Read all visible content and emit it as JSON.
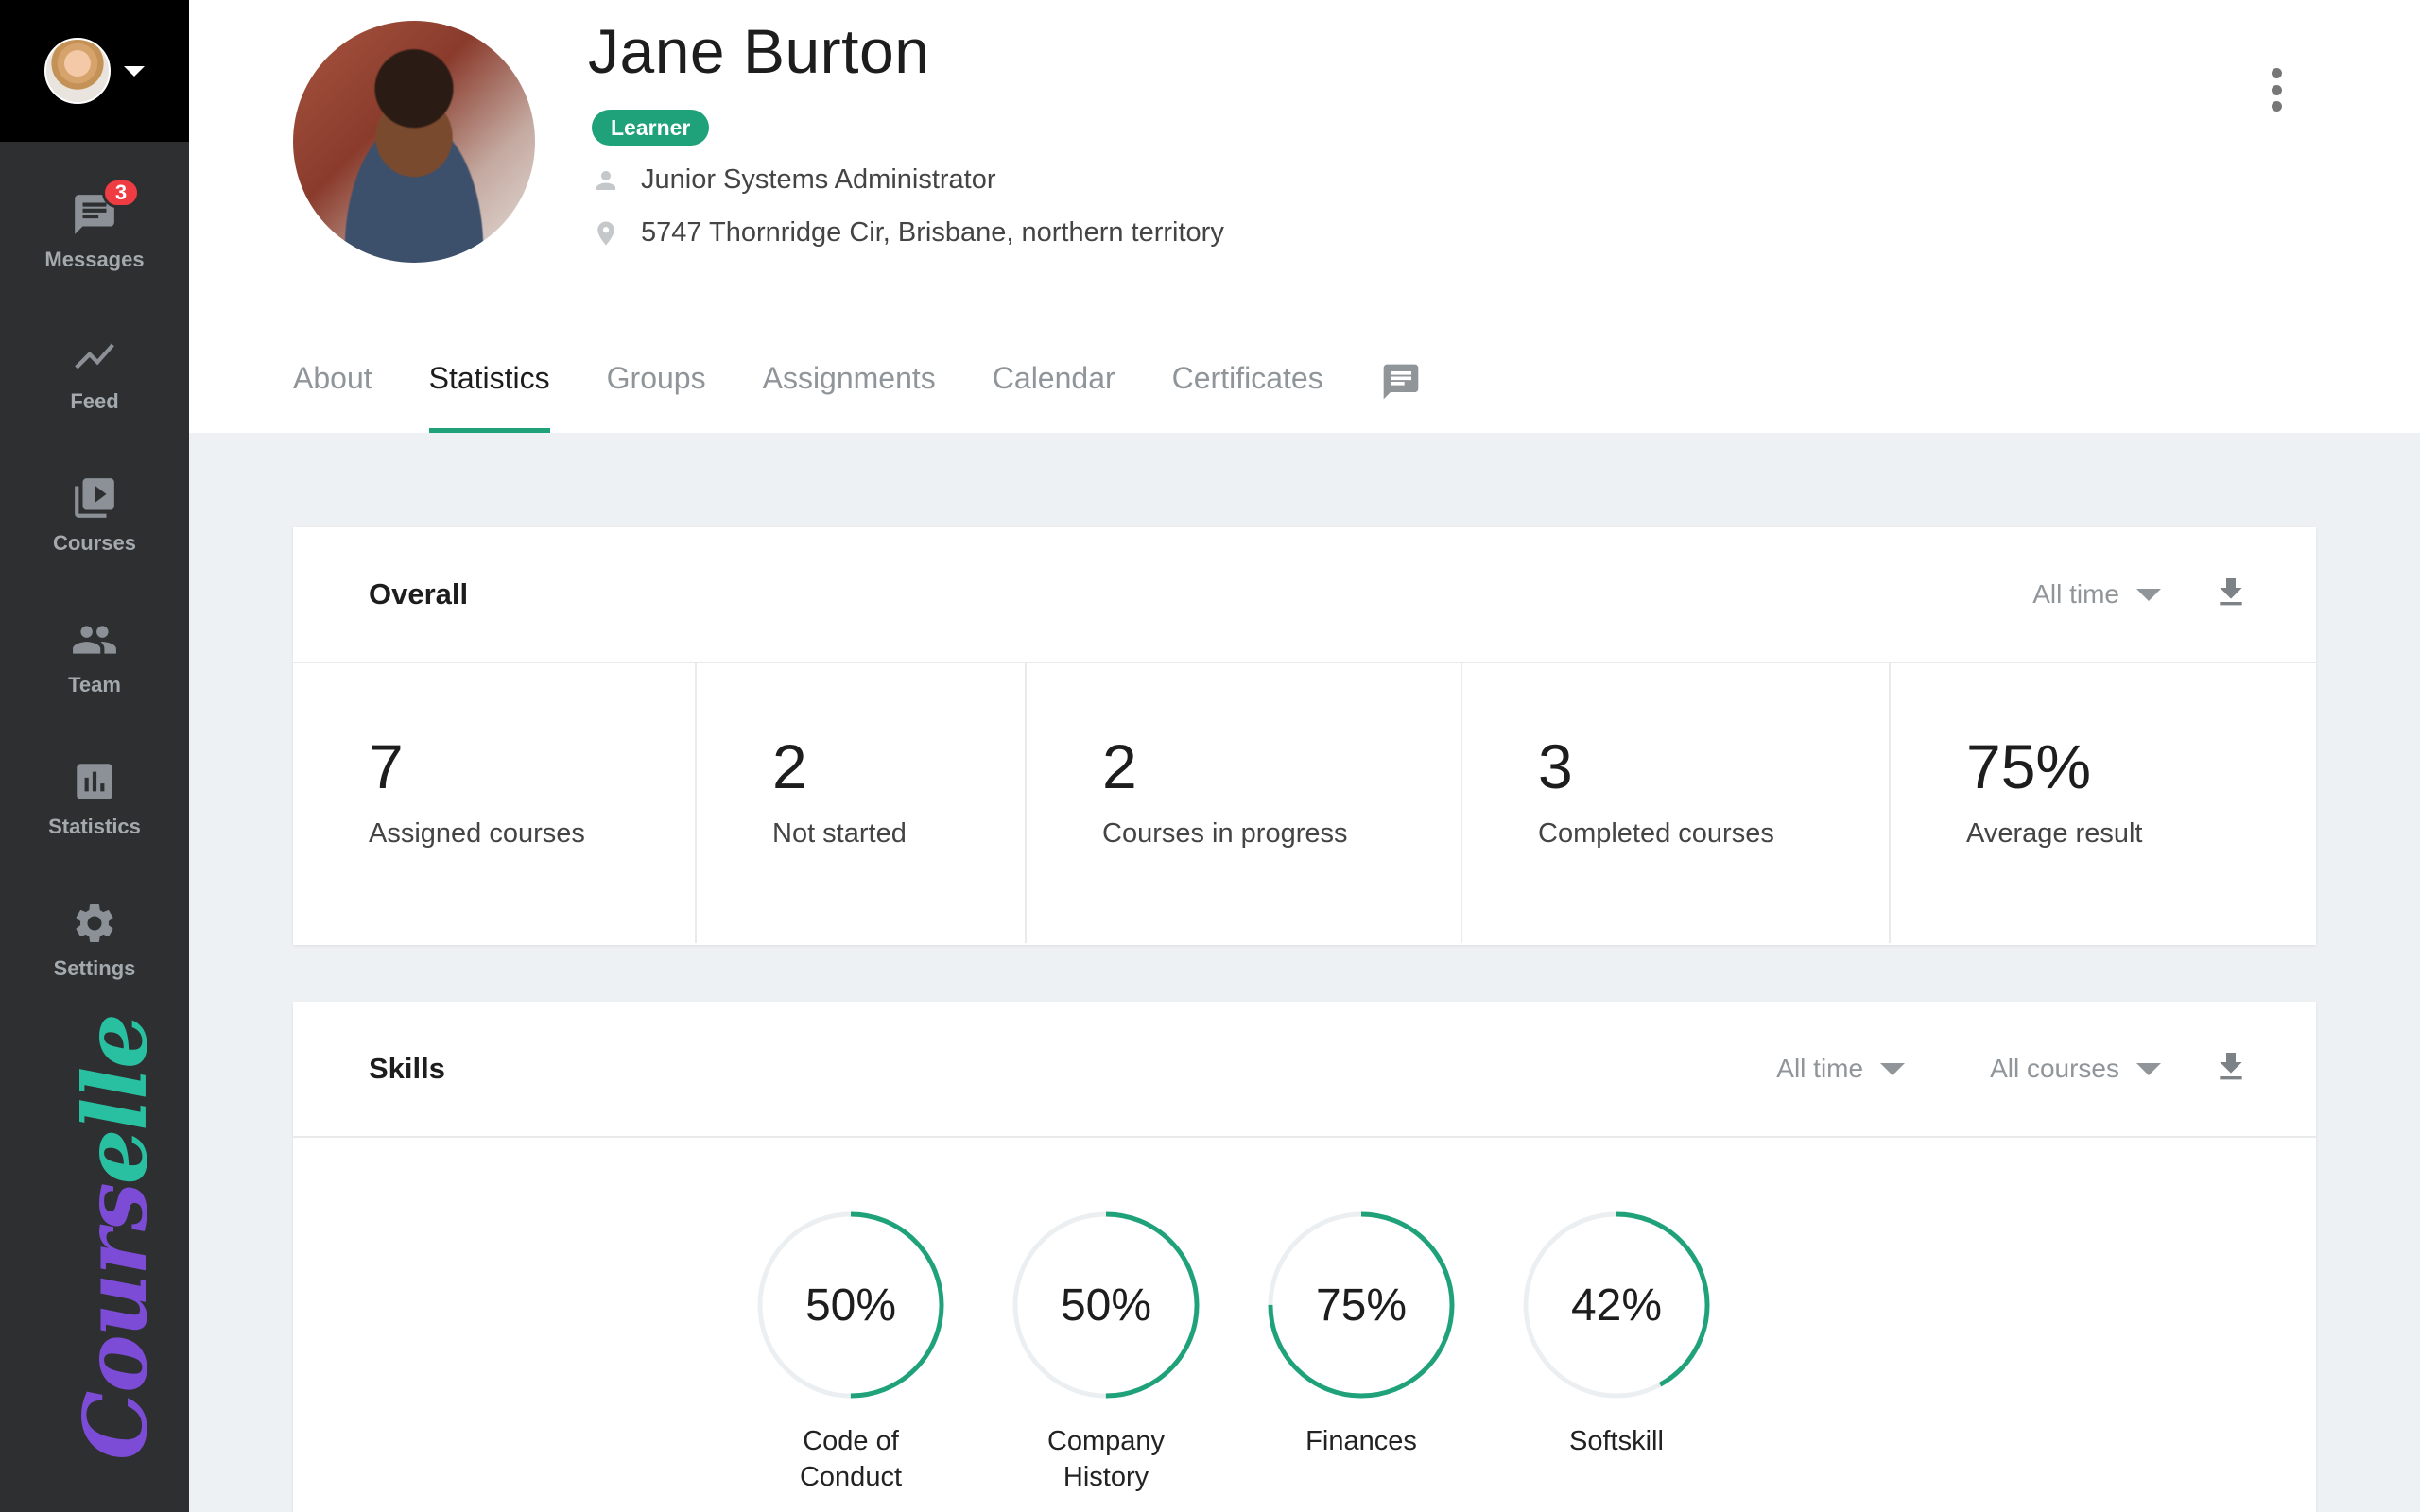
{
  "sidebar": {
    "items": [
      {
        "label": "Messages",
        "icon": "chat-icon",
        "badge": "3"
      },
      {
        "label": "Feed",
        "icon": "trend-icon"
      },
      {
        "label": "Courses",
        "icon": "video-library-icon"
      },
      {
        "label": "Team",
        "icon": "people-icon"
      },
      {
        "label": "Statistics",
        "icon": "bar-chart-icon"
      },
      {
        "label": "Settings",
        "icon": "gear-icon"
      }
    ],
    "logo_part1": "Cours",
    "logo_part2": "elle"
  },
  "profile": {
    "name": "Jane Burton",
    "role": "Learner",
    "job_title": "Junior Systems Administrator",
    "address": "5747 Thornridge Cir, Brisbane, northern territory"
  },
  "tabs": [
    {
      "label": "About",
      "active": false
    },
    {
      "label": "Statistics",
      "active": true
    },
    {
      "label": "Groups",
      "active": false
    },
    {
      "label": "Assignments",
      "active": false
    },
    {
      "label": "Calendar",
      "active": false
    },
    {
      "label": "Certificates",
      "active": false
    }
  ],
  "overall": {
    "title": "Overall",
    "filter": "All time",
    "stats": [
      {
        "value": "7",
        "label": "Assigned courses"
      },
      {
        "value": "2",
        "label": "Not started"
      },
      {
        "value": "2",
        "label": "Courses in progress"
      },
      {
        "value": "3",
        "label": "Completed courses"
      },
      {
        "value": "75%",
        "label": "Average result"
      }
    ]
  },
  "skills": {
    "title": "Skills",
    "time_filter": "All time",
    "course_filter": "All courses",
    "items": [
      {
        "pct": "50%",
        "value": 50,
        "label": "Code of Conduct"
      },
      {
        "pct": "50%",
        "value": 50,
        "label": "Company History"
      },
      {
        "pct": "75%",
        "value": 75,
        "label": "Finances"
      },
      {
        "pct": "42%",
        "value": 42,
        "label": "Softskill"
      }
    ]
  },
  "colors": {
    "accent": "#1fa27a",
    "badge": "#ef3b42",
    "sidebar": "#2d2f31"
  }
}
